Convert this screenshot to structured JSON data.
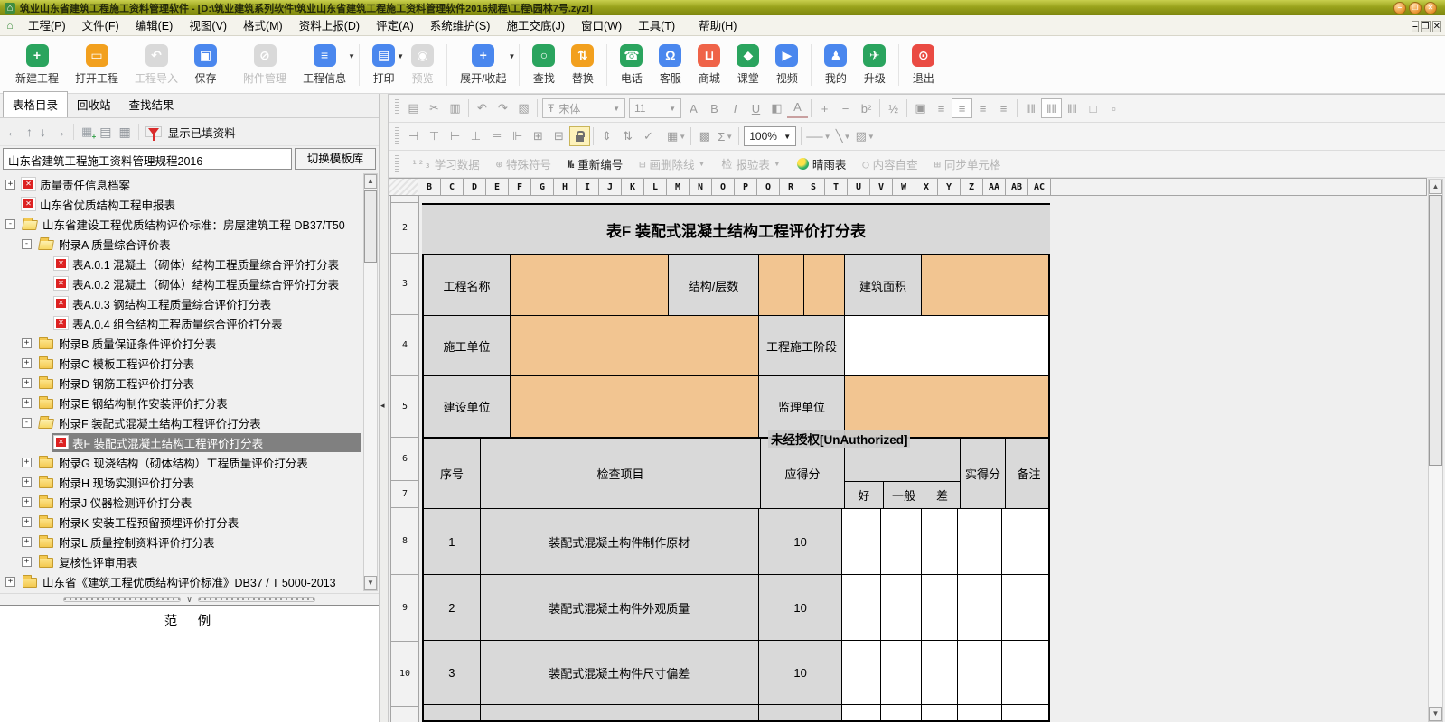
{
  "window": {
    "title": "筑业山东省建筑工程施工资料管理软件 - [D:\\筑业建筑系列软件\\筑业山东省建筑工程施工资料管理软件2016规程\\工程\\园林7号.zyzl]",
    "controls": [
      {
        "name": "minimize",
        "glyph": "–"
      },
      {
        "name": "restore",
        "glyph": "❐"
      },
      {
        "name": "close",
        "glyph": "✕"
      }
    ]
  },
  "menu": {
    "items": [
      "工程(P)",
      "文件(F)",
      "编辑(E)",
      "视图(V)",
      "格式(M)",
      "资料上报(D)",
      "评定(A)",
      "系统维护(S)",
      "施工交底(J)",
      "窗口(W)",
      "工具(T)",
      "帮助(H)"
    ],
    "controls": [
      {
        "name": "minimize",
        "glyph": "–"
      },
      {
        "name": "restore",
        "glyph": "❐"
      },
      {
        "name": "close",
        "glyph": "✕"
      }
    ]
  },
  "toolbar": {
    "buttons": [
      {
        "label": "新建工程",
        "icon": "new-project-icon",
        "glyph": "+",
        "color": "#2aa45e"
      },
      {
        "label": "打开工程",
        "icon": "open-project-icon",
        "glyph": "▭",
        "color": "#f2a01e"
      },
      {
        "label": "工程导入",
        "icon": "import-project-icon",
        "glyph": "↶",
        "disabled": true
      },
      {
        "label": "保存",
        "icon": "save-icon",
        "glyph": "▣",
        "color": "#4a87ee"
      },
      {
        "sep": true
      },
      {
        "label": "附件管理",
        "icon": "attachment-icon",
        "glyph": "⊘",
        "disabled": true
      },
      {
        "label": "工程信息",
        "icon": "project-info-icon",
        "glyph": "≡",
        "color": "#4a87ee",
        "dropdown": true
      },
      {
        "sep": true
      },
      {
        "label": "打印",
        "icon": "print-icon",
        "glyph": "▤",
        "color": "#4a87ee",
        "dropdown": true
      },
      {
        "label": "预览",
        "icon": "preview-icon",
        "glyph": "◉",
        "disabled": true
      },
      {
        "sep": true
      },
      {
        "label": "展开/收起",
        "icon": "expand-collapse-icon",
        "glyph": "+",
        "color": "#4a87ee",
        "dropdown": true
      },
      {
        "sep": true
      },
      {
        "label": "查找",
        "icon": "find-icon",
        "glyph": "○",
        "color": "#2aa45e"
      },
      {
        "label": "替换",
        "icon": "replace-icon",
        "glyph": "⇅",
        "color": "#f2a01e"
      },
      {
        "sep": true
      },
      {
        "label": "电话",
        "icon": "phone-icon",
        "glyph": "☎",
        "color": "#2aa45e"
      },
      {
        "label": "客服",
        "icon": "support-icon",
        "glyph": "Ω",
        "color": "#4a87ee"
      },
      {
        "label": "商城",
        "icon": "store-icon",
        "glyph": "⊔",
        "color": "#ef6348"
      },
      {
        "label": "课堂",
        "icon": "classroom-icon",
        "glyph": "◆",
        "color": "#2aa45e"
      },
      {
        "label": "视频",
        "icon": "video-icon",
        "glyph": "▶",
        "color": "#4a87ee"
      },
      {
        "sep": true
      },
      {
        "label": "我的",
        "icon": "my-account-icon",
        "glyph": "♟",
        "color": "#4a87ee"
      },
      {
        "label": "升级",
        "icon": "upgrade-icon",
        "glyph": "✈",
        "color": "#2aa45e"
      },
      {
        "sep": true
      },
      {
        "label": "退出",
        "icon": "exit-icon",
        "glyph": "⊙",
        "color": "#ea4b43"
      }
    ]
  },
  "sidebar": {
    "tabs": [
      {
        "label": "表格目录",
        "active": true
      },
      {
        "label": "回收站",
        "active": false
      },
      {
        "label": "查找结果",
        "active": false
      }
    ],
    "nav_icons": [
      {
        "name": "move-left-icon",
        "glyph": "←"
      },
      {
        "name": "move-up-icon",
        "glyph": "↑"
      },
      {
        "name": "move-down-icon",
        "glyph": "↓"
      },
      {
        "name": "move-right-icon",
        "glyph": "→"
      },
      {
        "sep": true
      },
      {
        "name": "add-form-icon",
        "glyph": "▦",
        "plus": true
      },
      {
        "name": "copy-form-icon",
        "glyph": "▤"
      },
      {
        "name": "delete-form-icon",
        "glyph": "▦"
      },
      {
        "sep": true
      }
    ],
    "filter_label": "显示已填资料",
    "template": {
      "name": "山东省建筑工程施工资料管理规程2016",
      "switch_label": "切换模板库"
    },
    "tree": [
      {
        "level": 0,
        "expander": "+",
        "icon": "form",
        "label": "质量责任信息档案"
      },
      {
        "level": 0,
        "expander": null,
        "icon": "form",
        "label": "山东省优质结构工程申报表"
      },
      {
        "level": 0,
        "expander": "-",
        "icon": "folder-open",
        "label": "山东省建设工程优质结构评价标准：房屋建筑工程 DB37/T50"
      },
      {
        "level": 1,
        "expander": "-",
        "icon": "folder-open",
        "label": "附录A 质量综合评价表"
      },
      {
        "level": 2,
        "expander": null,
        "icon": "form",
        "label": "表A.0.1 混凝土（砌体）结构工程质量综合评价打分表"
      },
      {
        "level": 2,
        "expander": null,
        "icon": "form",
        "label": "表A.0.2 混凝土（砌体）结构工程质量综合评价打分表"
      },
      {
        "level": 2,
        "expander": null,
        "icon": "form",
        "label": "表A.0.3 钢结构工程质量综合评价打分表"
      },
      {
        "level": 2,
        "expander": null,
        "icon": "form",
        "label": "表A.0.4 组合结构工程质量综合评价打分表"
      },
      {
        "level": 1,
        "expander": "+",
        "icon": "folder",
        "label": "附录B 质量保证条件评价打分表"
      },
      {
        "level": 1,
        "expander": "+",
        "icon": "folder",
        "label": "附录C 模板工程评价打分表"
      },
      {
        "level": 1,
        "expander": "+",
        "icon": "folder",
        "label": "附录D 钢筋工程评价打分表"
      },
      {
        "level": 1,
        "expander": "+",
        "icon": "folder",
        "label": "附录E 钢结构制作安装评价打分表"
      },
      {
        "level": 1,
        "expander": "-",
        "icon": "folder-open",
        "label": "附录F 装配式混凝土结构工程评价打分表"
      },
      {
        "level": 2,
        "expander": null,
        "icon": "form",
        "label": "表F 装配式混凝土结构工程评价打分表",
        "selected": true
      },
      {
        "level": 1,
        "expander": "+",
        "icon": "folder",
        "label": "附录G 现浇结构（砌体结构）工程质量评价打分表"
      },
      {
        "level": 1,
        "expander": "+",
        "icon": "folder",
        "label": "附录H 现场实测评价打分表"
      },
      {
        "level": 1,
        "expander": "+",
        "icon": "folder",
        "label": "附录J 仪器检测评价打分表"
      },
      {
        "level": 1,
        "expander": "+",
        "icon": "folder",
        "label": "附录K 安装工程预留预埋评价打分表"
      },
      {
        "level": 1,
        "expander": "+",
        "icon": "folder",
        "label": "附录L 质量控制资料评价打分表"
      },
      {
        "level": 1,
        "expander": "+",
        "icon": "folder",
        "label": "复核性评审用表"
      },
      {
        "level": 0,
        "expander": "+",
        "icon": "folder",
        "label": "山东省《建筑工程优质结构评价标准》DB37 / T 5000-2013"
      },
      {
        "level": 0,
        "expander": "+",
        "icon": "folder",
        "label": ""
      }
    ],
    "example_title": "范　例"
  },
  "editor": {
    "fontname": "宋体",
    "fontsize": "11",
    "zoom": "100%",
    "etb1": [
      {
        "n": "copy-icon",
        "g": "▤"
      },
      {
        "n": "cut-icon",
        "g": "✂"
      },
      {
        "n": "paste-icon",
        "g": "▥"
      },
      {
        "s": true
      },
      {
        "n": "undo-icon",
        "g": "↶"
      },
      {
        "n": "redo-icon",
        "g": "↷"
      },
      {
        "n": "delete-table-icon",
        "g": "▧"
      },
      {
        "s": true
      },
      {
        "sel": "fontname",
        "prefix": "Ŧ"
      },
      {
        "sel": "fontsize"
      },
      {
        "n": "font-style-icon",
        "g": "A"
      },
      {
        "n": "bold-icon",
        "g": "B"
      },
      {
        "n": "italic-icon",
        "g": "I"
      },
      {
        "n": "underline-icon",
        "g": "U"
      },
      {
        "n": "fill-color-icon",
        "g": "◧"
      },
      {
        "n": "font-color-icon",
        "g": "A"
      },
      {
        "s": true
      },
      {
        "n": "increase-icon",
        "g": "+"
      },
      {
        "n": "decrease-icon",
        "g": "−"
      },
      {
        "n": "superscript-icon",
        "g": "b²"
      },
      {
        "s": true
      },
      {
        "n": "fraction-icon",
        "g": "½"
      },
      {
        "s": true
      },
      {
        "n": "paragraph-icon",
        "g": "▣"
      },
      {
        "n": "align-left-icon",
        "g": "≡"
      },
      {
        "n": "align-center-icon",
        "g": "≡",
        "a": true
      },
      {
        "n": "align-right-icon",
        "g": "≡"
      },
      {
        "n": "align-justify-icon",
        "g": "≡"
      },
      {
        "s": true
      },
      {
        "n": "valign-top-icon",
        "g": "‖‖"
      },
      {
        "n": "valign-middle-icon",
        "g": "‖‖",
        "a": true
      },
      {
        "n": "valign-bottom-icon",
        "g": "‖‖"
      },
      {
        "n": "fit-cell-icon",
        "g": "□"
      },
      {
        "n": "shrink-cell-icon",
        "g": "▫"
      }
    ],
    "etb2": [
      {
        "n": "split-left-icon",
        "g": "⊣"
      },
      {
        "n": "merge-down-icon",
        "g": "⊤"
      },
      {
        "n": "split-right-icon",
        "g": "⊢"
      },
      {
        "n": "merge-up-icon",
        "g": "⊥"
      },
      {
        "n": "insert-row-icon",
        "g": "⊨"
      },
      {
        "n": "insert-col-icon",
        "g": "⊩"
      },
      {
        "n": "merge-cells-icon",
        "g": "⊞"
      },
      {
        "n": "split-cells-icon",
        "g": "⊟"
      },
      {
        "n": "lock-icon",
        "lock": true,
        "a": true
      },
      {
        "s": true
      },
      {
        "n": "row-spacing-icon",
        "g": "⇕"
      },
      {
        "n": "col-spacing-icon",
        "g": "⇅"
      },
      {
        "n": "spell-check-icon",
        "g": "✓"
      },
      {
        "s": true
      },
      {
        "n": "image-icon",
        "g": "▦",
        "dd": true
      },
      {
        "s": true
      },
      {
        "n": "border-icon",
        "g": "▩"
      },
      {
        "n": "sum-icon",
        "g": "Σ",
        "dd": true
      },
      {
        "s": true
      },
      {
        "sel": "zoom",
        "dark": true
      },
      {
        "s": true
      },
      {
        "n": "line-style-icon",
        "g": "──",
        "dd": true
      },
      {
        "n": "diagonal-icon",
        "g": "╲",
        "dd": true
      },
      {
        "n": "diagonal-box-icon",
        "g": "▨",
        "dd": true
      }
    ],
    "etb3": [
      {
        "label": "学习数据",
        "icon": "learning-data-icon",
        "glyph": "¹²₃",
        "disabled": true
      },
      {
        "label": "特殊符号",
        "icon": "special-symbol-icon",
        "glyph": "⊕",
        "disabled": true
      },
      {
        "label": "重新编号",
        "icon": "renumber-icon",
        "glyph": "№",
        "disabled": false
      },
      {
        "label": "画删除线",
        "icon": "strike-line-icon",
        "glyph": "⊟",
        "disabled": true,
        "dropdown": true
      },
      {
        "label": "报验表",
        "icon": "inspection-form-icon",
        "glyph": "检",
        "disabled": true,
        "dropdown": true
      },
      {
        "label": "晴雨表",
        "icon": "barometer-icon",
        "glyph": "",
        "disabled": false,
        "colored": true
      },
      {
        "label": "内容自查",
        "icon": "content-self-check-icon",
        "glyph": "○",
        "disabled": true
      },
      {
        "label": "同步单元格",
        "icon": "sync-cell-icon",
        "glyph": "⊞",
        "disabled": true
      }
    ],
    "columns": [
      "B",
      "C",
      "D",
      "E",
      "F",
      "G",
      "H",
      "I",
      "J",
      "K",
      "L",
      "M",
      "N",
      "O",
      "P",
      "Q",
      "R",
      "S",
      "T",
      "U",
      "V",
      "W",
      "X",
      "Y",
      "Z",
      "AA",
      "AB",
      "AC"
    ],
    "row_numbers": [
      "2",
      "3",
      "4",
      "5",
      "6",
      "7",
      "8",
      "9",
      "10"
    ],
    "watermark": "未经授权[UnAuthorized]",
    "table": {
      "title": "表F  装配式混凝土结构工程评价打分表",
      "labels": {
        "project_name": "工程名称",
        "structure_floors": "结构/层数",
        "building_area": "建筑面积",
        "construction_unit": "施工单位",
        "construction_stage": "工程施工阶段",
        "client_unit": "建设单位",
        "supervision_unit": "监理单位",
        "no": "序号",
        "check_item": "检查项目",
        "deserved_score": "应得分",
        "good": "好",
        "normal": "一般",
        "poor": "差",
        "actual_score": "实得分",
        "remark": "备注"
      },
      "items": [
        {
          "no": "1",
          "name": "装配式混凝土构件制作原材",
          "score": "10"
        },
        {
          "no": "2",
          "name": "装配式混凝土构件外观质量",
          "score": "10"
        },
        {
          "no": "3",
          "name": "装配式混凝土构件尺寸偏差",
          "score": "10"
        }
      ]
    }
  }
}
